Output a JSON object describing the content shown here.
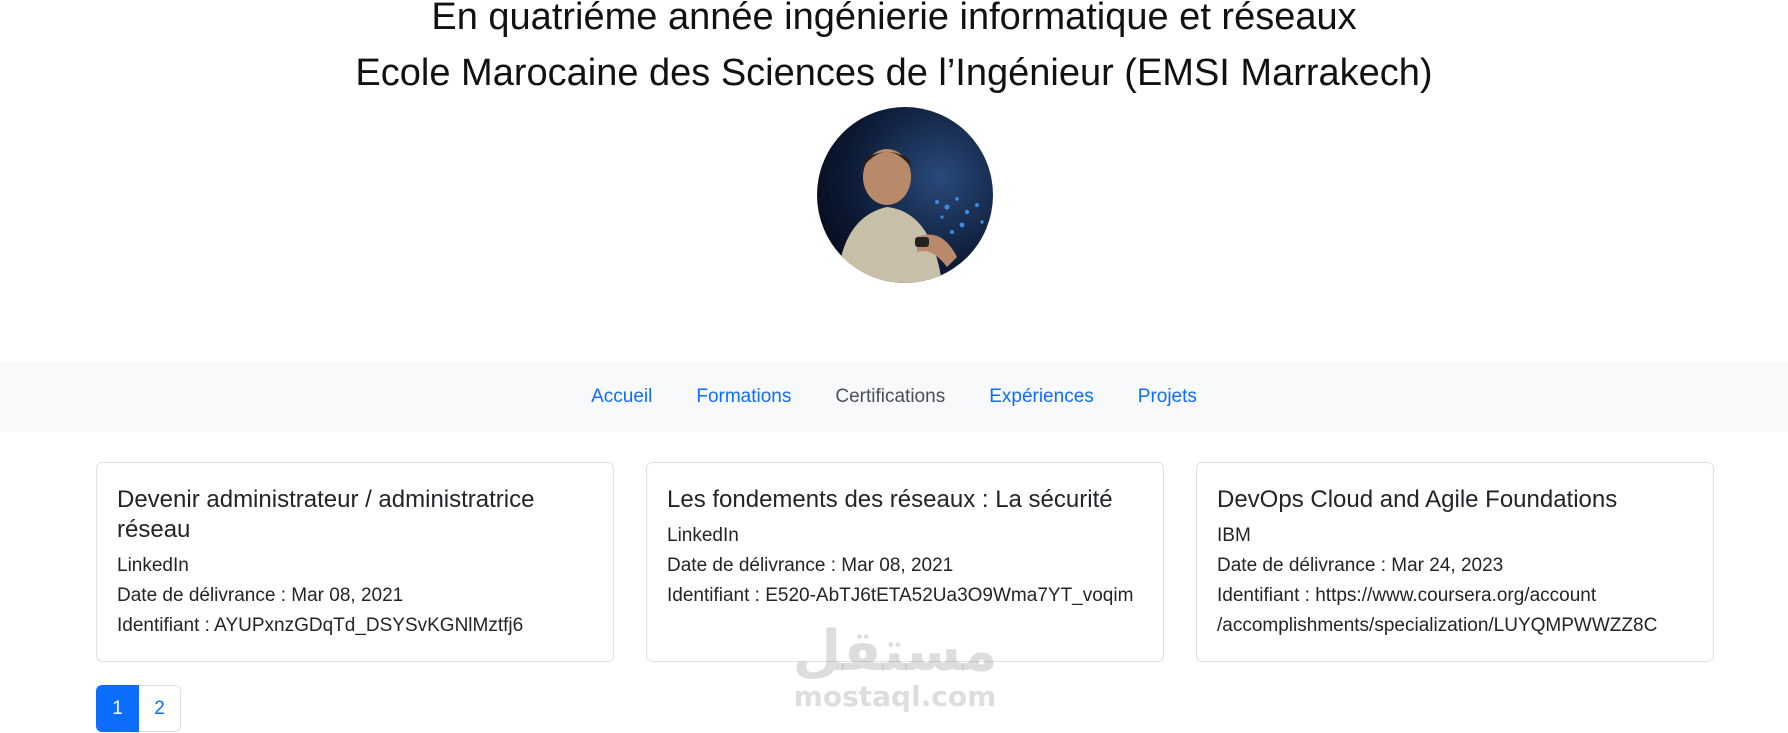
{
  "header": {
    "line1": "En quatriéme année ingénierie informatique et réseaux",
    "line2": "Ecole Marocaine des Sciences de l’Ingénieur (EMSI Marrakech)"
  },
  "nav": {
    "items": [
      {
        "label": "Accueil",
        "active": false
      },
      {
        "label": "Formations",
        "active": false
      },
      {
        "label": "Certifications",
        "active": true
      },
      {
        "label": "Expériences",
        "active": false
      },
      {
        "label": "Projets",
        "active": false
      }
    ]
  },
  "cards": [
    {
      "title": "Devenir administrateur / administratrice réseau",
      "issuer": "LinkedIn",
      "date": "Date de délivrance : Mar 08, 2021",
      "identifier": "Identifiant : AYUPxnzGDqTd_DSYSvKGNlMztfj6"
    },
    {
      "title": "Les fondements des réseaux : La sécurité",
      "issuer": "LinkedIn",
      "date": "Date de délivrance : Mar 08, 2021",
      "identifier": "Identifiant : E520-AbTJ6tETA52Ua3O9Wma7YT_voqim"
    },
    {
      "title": "DevOps Cloud and Agile Foundations",
      "issuer": "IBM",
      "date": "Date de délivrance : Mar 24, 2023",
      "identifier": "Identifiant : https://www.coursera.org/account /accomplishments/specialization/LUYQMPWWZZ8C"
    }
  ],
  "pagination": {
    "pages": [
      "1",
      "2"
    ],
    "current": "1"
  },
  "watermark": {
    "arabic": "مستقل",
    "latin": "mostaql.com"
  },
  "colors": {
    "link": "#0d6efd",
    "navbar_bg": "#f8f9fa",
    "active_nav": "#495057"
  }
}
